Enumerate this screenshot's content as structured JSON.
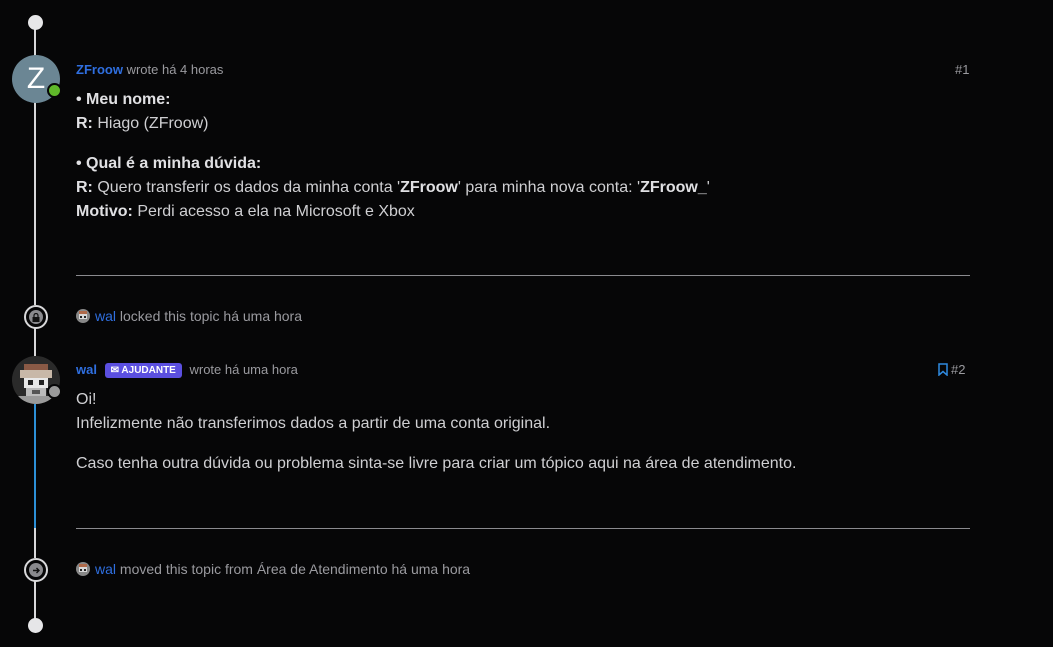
{
  "posts": [
    {
      "avatar_letter": "Z",
      "username": "ZFroow",
      "meta": "wrote há 4 horas",
      "number": "#1",
      "q1_label": "• Meu nome:",
      "r_label": "R:",
      "r1_text": " Hiago (ZFroow)",
      "q2_label": "• Qual é a minha dúvida:",
      "r2_a": " Quero transferir os dados da minha conta '",
      "r2_b": "ZFroow",
      "r2_c": "' para minha nova conta: '",
      "r2_d": "ZFroow_",
      "r2_e": "'",
      "motivo_label": "Motivo:",
      "motivo_text": " Perdi acesso a ela na Microsoft e Xbox"
    },
    {
      "username": "wal",
      "badge": "AJUDANTE",
      "meta": "wrote há uma hora",
      "number": "#2",
      "line1": "Oi!",
      "line2": "Infelizmente não transferimos dados a partir de uma conta original.",
      "line3": "Caso tenha outra dúvida ou problema sinta-se livre para criar um tópico aqui na área de atendimento."
    }
  ],
  "events": [
    {
      "username": "wal",
      "text": "locked this topic há uma hora",
      "icon": "lock-icon"
    },
    {
      "username": "wal",
      "text": "moved this topic from Área de Atendimento há uma hora",
      "icon": "arrow-right-icon"
    }
  ],
  "colors": {
    "accent": "#2f6fe0",
    "online": "#5fb82a",
    "badge": "#5b4fe0",
    "timeline_active": "#2c8fd6"
  }
}
